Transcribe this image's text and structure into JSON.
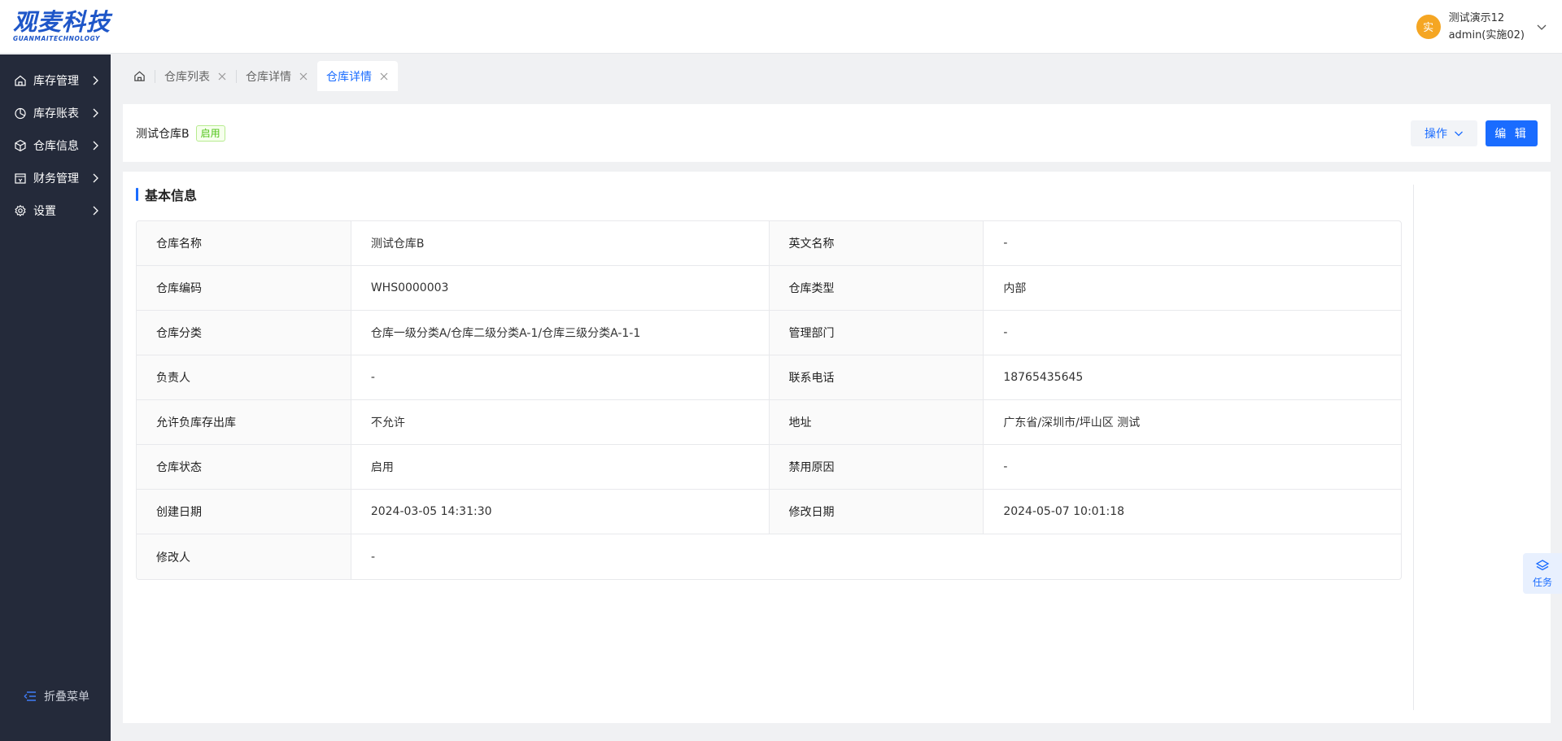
{
  "header": {
    "logo_main": "观麦科技",
    "logo_sub": "GUANMAITECHNOLOGY",
    "avatar_text": "实",
    "user_line1": "测试演示12",
    "user_line2": "admin(实施02)"
  },
  "sidebar": {
    "items": [
      {
        "label": "库存管理",
        "icon": "home-icon"
      },
      {
        "label": "库存账表",
        "icon": "pie-chart-icon"
      },
      {
        "label": "仓库信息",
        "icon": "cube-icon"
      },
      {
        "label": "财务管理",
        "icon": "wallet-icon"
      },
      {
        "label": "设置",
        "icon": "gear-icon"
      }
    ],
    "collapse_label": "折叠菜单"
  },
  "tabs": [
    {
      "label": "仓库列表"
    },
    {
      "label": "仓库详情"
    },
    {
      "label": "仓库详情",
      "active": true
    }
  ],
  "title_card": {
    "warehouse_name": "测试仓库B",
    "status_badge": "启用",
    "op_label": "操作",
    "edit_label": "编 辑"
  },
  "section": {
    "title": "基本信息"
  },
  "details": {
    "rows": [
      [
        {
          "label": "仓库名称",
          "value": "测试仓库B"
        },
        {
          "label": "英文名称",
          "value": "-"
        }
      ],
      [
        {
          "label": "仓库编码",
          "value": "WHS0000003"
        },
        {
          "label": "仓库类型",
          "value": "内部"
        }
      ],
      [
        {
          "label": "仓库分类",
          "value": "仓库一级分类A/仓库二级分类A-1/仓库三级分类A-1-1"
        },
        {
          "label": "管理部门",
          "value": "-"
        }
      ],
      [
        {
          "label": "负责人",
          "value": "-"
        },
        {
          "label": "联系电话",
          "value": "18765435645"
        }
      ],
      [
        {
          "label": "允许负库存出库",
          "value": "不允许"
        },
        {
          "label": "地址",
          "value": "广东省/深圳市/坪山区 测试"
        }
      ],
      [
        {
          "label": "仓库状态",
          "value": "启用"
        },
        {
          "label": "禁用原因",
          "value": "-"
        }
      ],
      [
        {
          "label": "创建日期",
          "value": "2024-03-05 14:31:30"
        },
        {
          "label": "修改日期",
          "value": "2024-05-07 10:01:18"
        }
      ],
      [
        {
          "label": "修改人",
          "value": "-"
        }
      ]
    ]
  },
  "float_task": {
    "label": "任务"
  },
  "colors": {
    "primary": "#1a6cff",
    "sidebar_bg": "#242a3a",
    "success": "#52c41a",
    "avatar": "#f5a623"
  }
}
